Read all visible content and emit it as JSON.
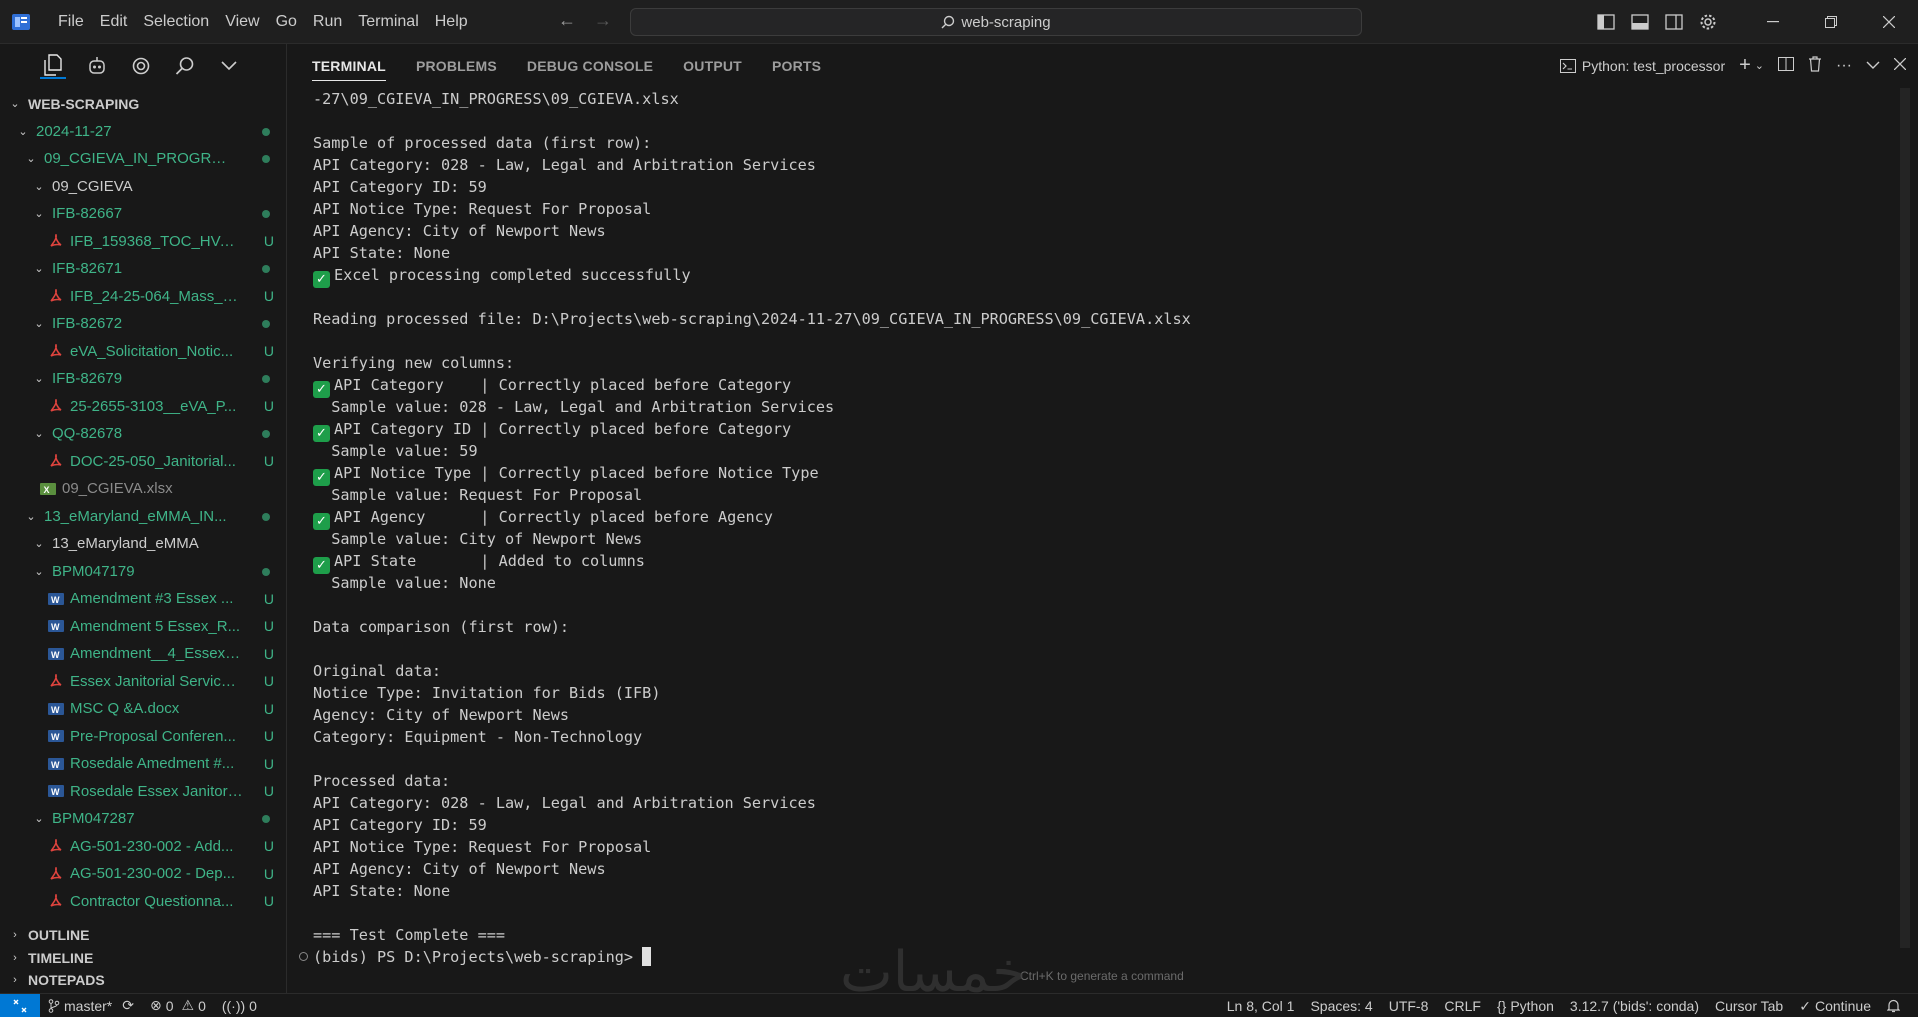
{
  "titlebar": {
    "menu": [
      "File",
      "Edit",
      "Selection",
      "View",
      "Go",
      "Run",
      "Terminal",
      "Help"
    ],
    "search_text": "web-scraping"
  },
  "explorer": {
    "root": "WEB-SCRAPING",
    "items": [
      {
        "label": "2024-11-27",
        "depth": 1,
        "kind": "folder",
        "color": "g",
        "status": "dot"
      },
      {
        "label": "09_CGIEVA_IN_PROGRESS",
        "depth": 2,
        "kind": "folder",
        "color": "g",
        "status": "dot"
      },
      {
        "label": "09_CGIEVA",
        "depth": 3,
        "kind": "folder",
        "color": "w",
        "status": ""
      },
      {
        "label": "IFB-82667",
        "depth": 3,
        "kind": "folder",
        "color": "g",
        "status": "dot"
      },
      {
        "label": "IFB_159368_TOC_HVAC...",
        "depth": 4,
        "kind": "pdf",
        "color": "g",
        "status": "U"
      },
      {
        "label": "IFB-82671",
        "depth": 3,
        "kind": "folder",
        "color": "g",
        "status": "dot"
      },
      {
        "label": "IFB_24-25-064_Mass_Tr...",
        "depth": 4,
        "kind": "pdf",
        "color": "g",
        "status": "U"
      },
      {
        "label": "IFB-82672",
        "depth": 3,
        "kind": "folder",
        "color": "g",
        "status": "dot"
      },
      {
        "label": "eVA_Solicitation_Notic...",
        "depth": 4,
        "kind": "pdf",
        "color": "g",
        "status": "U"
      },
      {
        "label": "IFB-82679",
        "depth": 3,
        "kind": "folder",
        "color": "g",
        "status": "dot"
      },
      {
        "label": "25-2655-3103__eVA_P...",
        "depth": 4,
        "kind": "pdf",
        "color": "g",
        "status": "U"
      },
      {
        "label": "QQ-82678",
        "depth": 3,
        "kind": "folder",
        "color": "g",
        "status": "dot"
      },
      {
        "label": "DOC-25-050_Janitorial...",
        "depth": 4,
        "kind": "pdf",
        "color": "g",
        "status": "U"
      },
      {
        "label": "09_CGIEVA.xlsx",
        "depth": 3,
        "kind": "xlsx",
        "color": "dim",
        "status": ""
      },
      {
        "label": "13_eMaryland_eMMA_IN...",
        "depth": 2,
        "kind": "folder",
        "color": "g",
        "status": "dot"
      },
      {
        "label": "13_eMaryland_eMMA",
        "depth": 3,
        "kind": "folder",
        "color": "w",
        "status": ""
      },
      {
        "label": "BPM047179",
        "depth": 3,
        "kind": "folder",
        "color": "g",
        "status": "dot"
      },
      {
        "label": "Amendment #3 Essex ...",
        "depth": 4,
        "kind": "docx",
        "color": "g",
        "status": "U"
      },
      {
        "label": "Amendment 5 Essex_R...",
        "depth": 4,
        "kind": "docx",
        "color": "g",
        "status": "U"
      },
      {
        "label": "Amendment__4_Essex_...",
        "depth": 4,
        "kind": "docx",
        "color": "g",
        "status": "U"
      },
      {
        "label": "Essex Janitorial Service ...",
        "depth": 4,
        "kind": "pdf",
        "color": "g",
        "status": "U"
      },
      {
        "label": "MSC Q &A.docx",
        "depth": 4,
        "kind": "docx",
        "color": "g",
        "status": "U"
      },
      {
        "label": "Pre-Proposal Conferen...",
        "depth": 4,
        "kind": "docx",
        "color": "g",
        "status": "U"
      },
      {
        "label": "Rosedale Amedment #...",
        "depth": 4,
        "kind": "docx",
        "color": "g",
        "status": "U"
      },
      {
        "label": "Rosedale Essex Janitori...",
        "depth": 4,
        "kind": "docx",
        "color": "g",
        "status": "U"
      },
      {
        "label": "BPM047287",
        "depth": 3,
        "kind": "folder",
        "color": "g",
        "status": "dot"
      },
      {
        "label": "AG-501-230-002 - Add...",
        "depth": 4,
        "kind": "pdf",
        "color": "g",
        "status": "U"
      },
      {
        "label": "AG-501-230-002 - Dep...",
        "depth": 4,
        "kind": "pdf",
        "color": "g",
        "status": "U"
      },
      {
        "label": "Contractor Questionna...",
        "depth": 4,
        "kind": "pdf",
        "color": "g",
        "status": "U"
      }
    ],
    "sections": [
      "OUTLINE",
      "TIMELINE",
      "NOTEPADS"
    ]
  },
  "panel": {
    "tabs": [
      "TERMINAL",
      "PROBLEMS",
      "DEBUG CONSOLE",
      "OUTPUT",
      "PORTS"
    ],
    "terminal_name": "Python: test_processor",
    "lines": [
      {
        "t": "-27\\09_CGIEVA_IN_PROGRESS\\09_CGIEVA.xlsx"
      },
      {
        "t": ""
      },
      {
        "t": "Sample of processed data (first row):"
      },
      {
        "t": "API Category: 028 - Law, Legal and Arbitration Services"
      },
      {
        "t": "API Category ID: 59"
      },
      {
        "t": "API Notice Type: Request For Proposal"
      },
      {
        "t": "API Agency: City of Newport News"
      },
      {
        "t": "API State: None"
      },
      {
        "t": "Excel processing completed successfully",
        "check": true
      },
      {
        "t": ""
      },
      {
        "t": "Reading processed file: D:\\Projects\\web-scraping\\2024-11-27\\09_CGIEVA_IN_PROGRESS\\09_CGIEVA.xlsx"
      },
      {
        "t": ""
      },
      {
        "t": "Verifying new columns:"
      },
      {
        "t": "API Category    | Correctly placed before Category",
        "check": true
      },
      {
        "t": "  Sample value: 028 - Law, Legal and Arbitration Services"
      },
      {
        "t": "API Category ID | Correctly placed before Category",
        "check": true
      },
      {
        "t": "  Sample value: 59"
      },
      {
        "t": "API Notice Type | Correctly placed before Notice Type",
        "check": true
      },
      {
        "t": "  Sample value: Request For Proposal"
      },
      {
        "t": "API Agency      | Correctly placed before Agency",
        "check": true
      },
      {
        "t": "  Sample value: City of Newport News"
      },
      {
        "t": "API State       | Added to columns",
        "check": true
      },
      {
        "t": "  Sample value: None"
      },
      {
        "t": ""
      },
      {
        "t": "Data comparison (first row):"
      },
      {
        "t": ""
      },
      {
        "t": "Original data:"
      },
      {
        "t": "Notice Type: Invitation for Bids (IFB)"
      },
      {
        "t": "Agency: City of Newport News"
      },
      {
        "t": "Category: Equipment - Non-Technology"
      },
      {
        "t": ""
      },
      {
        "t": "Processed data:"
      },
      {
        "t": "API Category: 028 - Law, Legal and Arbitration Services"
      },
      {
        "t": "API Category ID: 59"
      },
      {
        "t": "API Notice Type: Request For Proposal"
      },
      {
        "t": "API Agency: City of Newport News"
      },
      {
        "t": "API State: None"
      },
      {
        "t": ""
      },
      {
        "t": "=== Test Complete ==="
      }
    ],
    "prompt": "(bids) PS D:\\Projects\\web-scraping> ",
    "hint": "Ctrl+K to generate a command"
  },
  "statusbar": {
    "branch": "master*",
    "errors": "0",
    "warnings": "0",
    "ports": "0",
    "position": "Ln 8, Col 1",
    "spaces": "Spaces: 4",
    "encoding": "UTF-8",
    "eol": "CRLF",
    "language": "Python",
    "interpreter": "3.12.7 ('bids': conda)",
    "cursor_tab": "Cursor Tab",
    "continue": "Continue"
  },
  "watermark": "خمسات",
  "colors": {
    "accent": "#0078d4",
    "untracked": "#3fb488",
    "check": "#1e9e4a"
  }
}
